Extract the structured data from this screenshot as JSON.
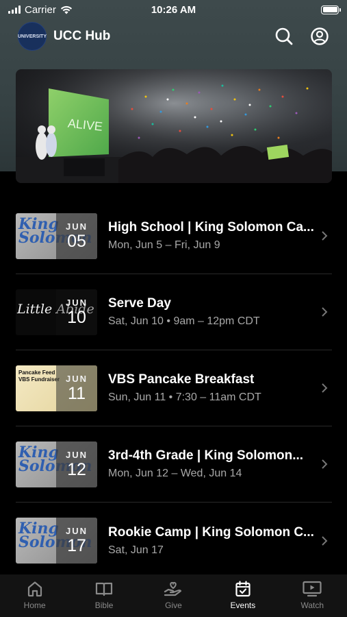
{
  "status": {
    "carrier": "Carrier",
    "time": "10:26 AM"
  },
  "header": {
    "title": "UCC Hub",
    "logo_text": "UNIVERSITY"
  },
  "hero": {
    "banner_text": "ALIVE"
  },
  "events": [
    {
      "month": "JUN",
      "day": "05",
      "title": "High School | King Solomon Ca...",
      "subtitle": "Mon, Jun 5 – Fri, Jun 9",
      "thumb": "King Solomon"
    },
    {
      "month": "JUN",
      "day": "10",
      "title": "Serve Day",
      "subtitle": "Sat, Jun 10 • 9am – 12pm CDT",
      "thumb": "Little Abide"
    },
    {
      "month": "JUN",
      "day": "11",
      "title": "VBS Pancake Breakfast",
      "subtitle": "Sun, Jun 11 • 7:30 – 11am CDT",
      "thumb": "Pancake Feed VBS Fundraiser"
    },
    {
      "month": "JUN",
      "day": "12",
      "title": "3rd-4th Grade | King Solomon...",
      "subtitle": "Mon, Jun 12 – Wed, Jun 14",
      "thumb": "King Solomon"
    },
    {
      "month": "JUN",
      "day": "17",
      "title": "Rookie Camp | King Solomon C...",
      "subtitle": "Sat, Jun 17",
      "thumb": "King Solomon"
    }
  ],
  "tabs": [
    {
      "label": "Home",
      "icon": "home-icon",
      "active": false
    },
    {
      "label": "Bible",
      "icon": "book-icon",
      "active": false
    },
    {
      "label": "Give",
      "icon": "give-icon",
      "active": false
    },
    {
      "label": "Events",
      "icon": "calendar-icon",
      "active": true
    },
    {
      "label": "Watch",
      "icon": "tv-icon",
      "active": false
    }
  ],
  "colors": {
    "background": "#000000",
    "header_bg": "#3a4648",
    "tab_active": "#ffffff",
    "tab_inactive": "#8a8a8a"
  }
}
